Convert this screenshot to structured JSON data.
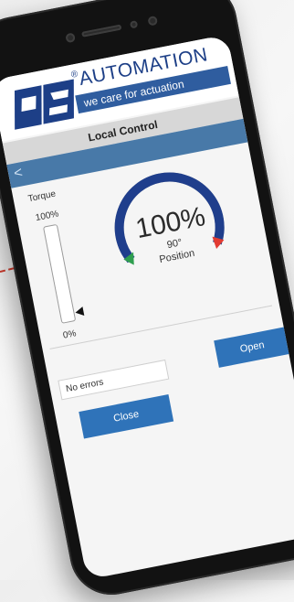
{
  "brand": {
    "logo_letters": "PS",
    "name": "AUTOMATION",
    "registered": "®",
    "tagline": "we care for actuation"
  },
  "page": {
    "title": "Local Control",
    "back_symbol": "<"
  },
  "torque": {
    "label": "Torque",
    "max": "100%",
    "min": "0%",
    "level_fraction": 0.0
  },
  "position": {
    "percent": "100%",
    "degrees": "90°",
    "label": "Position",
    "level_fraction": 1.0
  },
  "status": {
    "text": "No errors"
  },
  "buttons": {
    "open": "Open",
    "close": "Close"
  },
  "colors": {
    "brand_blue": "#1d3f87",
    "tagline_blue": "#2f5d9f",
    "nav_blue": "#4879a8",
    "button_blue": "#2f73b9",
    "gauge_arc": "#1f3e8c",
    "gauge_track": "#a6a6a6",
    "closed_marker": "#2f9e4f",
    "open_marker": "#e23b32"
  },
  "icons": {
    "back": "chevron-left-icon"
  }
}
